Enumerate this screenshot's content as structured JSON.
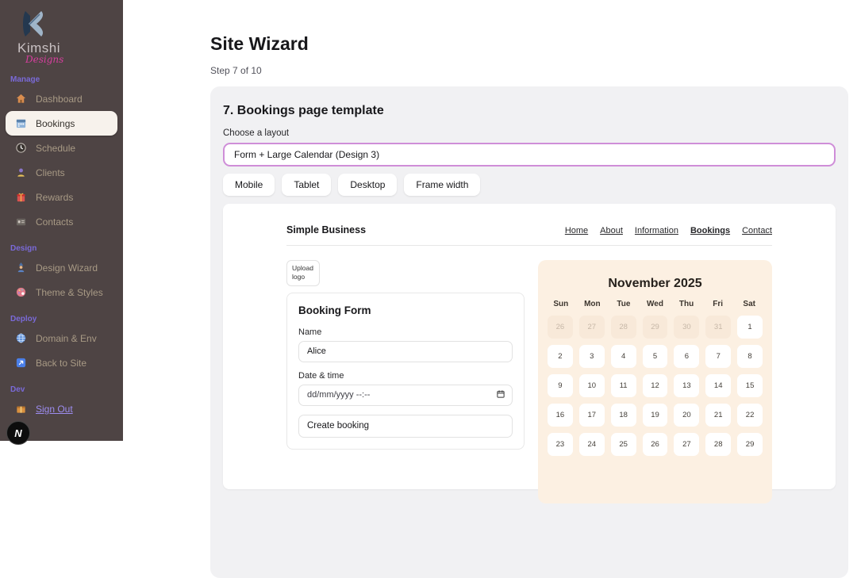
{
  "sidebar": {
    "logo": {
      "title": "Kimshi",
      "subtitle": "Designs"
    },
    "sections": [
      {
        "label": "Manage",
        "items": [
          {
            "icon": "home-icon",
            "label": "Dashboard"
          },
          {
            "icon": "calendar-icon",
            "label": "Bookings",
            "active": true
          },
          {
            "icon": "clock-icon",
            "label": "Schedule"
          },
          {
            "icon": "person-icon",
            "label": "Clients"
          },
          {
            "icon": "gift-icon",
            "label": "Rewards"
          },
          {
            "icon": "contact-card-icon",
            "label": "Contacts"
          }
        ]
      },
      {
        "label": "Design",
        "items": [
          {
            "icon": "wizard-icon",
            "label": "Design Wizard"
          },
          {
            "icon": "palette-icon",
            "label": "Theme & Styles"
          }
        ]
      },
      {
        "label": "Deploy",
        "items": [
          {
            "icon": "globe-icon",
            "label": "Domain & Env"
          },
          {
            "icon": "back-arrow-icon",
            "label": "Back to Site"
          }
        ]
      },
      {
        "label": "Dev",
        "items": [
          {
            "icon": "package-icon",
            "label": "Sign Out",
            "link": true
          }
        ]
      }
    ],
    "dev_badge": "N"
  },
  "main": {
    "title": "Site Wizard",
    "step": "Step 7 of 10",
    "panel": {
      "heading": "7. Bookings page template",
      "layout_label": "Choose a layout",
      "layout_value": "Form + Large Calendar (Design 3)",
      "device_buttons": [
        "Mobile",
        "Tablet",
        "Desktop",
        "Frame width"
      ]
    },
    "preview": {
      "site_name": "Simple Business",
      "nav": [
        "Home",
        "About",
        "Information",
        "Bookings",
        "Contact"
      ],
      "active_nav": "Bookings",
      "upload_logo_label": "Upload logo",
      "form": {
        "title": "Booking Form",
        "name_label": "Name",
        "name_value": "Alice",
        "datetime_label": "Date & time",
        "datetime_placeholder": "dd/mm/yyyy --:--",
        "submit_label": "Create booking"
      },
      "calendar": {
        "title": "November 2025",
        "weekdays": [
          "Sun",
          "Mon",
          "Tue",
          "Wed",
          "Thu",
          "Fri",
          "Sat"
        ],
        "weeks": [
          [
            {
              "d": "26",
              "muted": true
            },
            {
              "d": "27",
              "muted": true
            },
            {
              "d": "28",
              "muted": true
            },
            {
              "d": "29",
              "muted": true
            },
            {
              "d": "30",
              "muted": true
            },
            {
              "d": "31",
              "muted": true
            },
            {
              "d": "1"
            }
          ],
          [
            {
              "d": "2"
            },
            {
              "d": "3"
            },
            {
              "d": "4"
            },
            {
              "d": "5"
            },
            {
              "d": "6"
            },
            {
              "d": "7"
            },
            {
              "d": "8"
            }
          ],
          [
            {
              "d": "9"
            },
            {
              "d": "10"
            },
            {
              "d": "11"
            },
            {
              "d": "12"
            },
            {
              "d": "13"
            },
            {
              "d": "14"
            },
            {
              "d": "15"
            }
          ],
          [
            {
              "d": "16"
            },
            {
              "d": "17"
            },
            {
              "d": "18"
            },
            {
              "d": "19"
            },
            {
              "d": "20"
            },
            {
              "d": "21"
            },
            {
              "d": "22"
            }
          ],
          [
            {
              "d": "23"
            },
            {
              "d": "24"
            },
            {
              "d": "25"
            },
            {
              "d": "26"
            },
            {
              "d": "27"
            },
            {
              "d": "28"
            },
            {
              "d": "29"
            }
          ]
        ]
      }
    }
  },
  "colors": {
    "sidebar_bg": "#4e4444",
    "accent_purple": "#7a6ad8",
    "link_purple": "#9d8df0",
    "select_border": "#cf8ed8",
    "panel_bg": "#f1f1f3",
    "calendar_bg": "#fcf0e2",
    "logo_pink": "#d63f9e"
  }
}
